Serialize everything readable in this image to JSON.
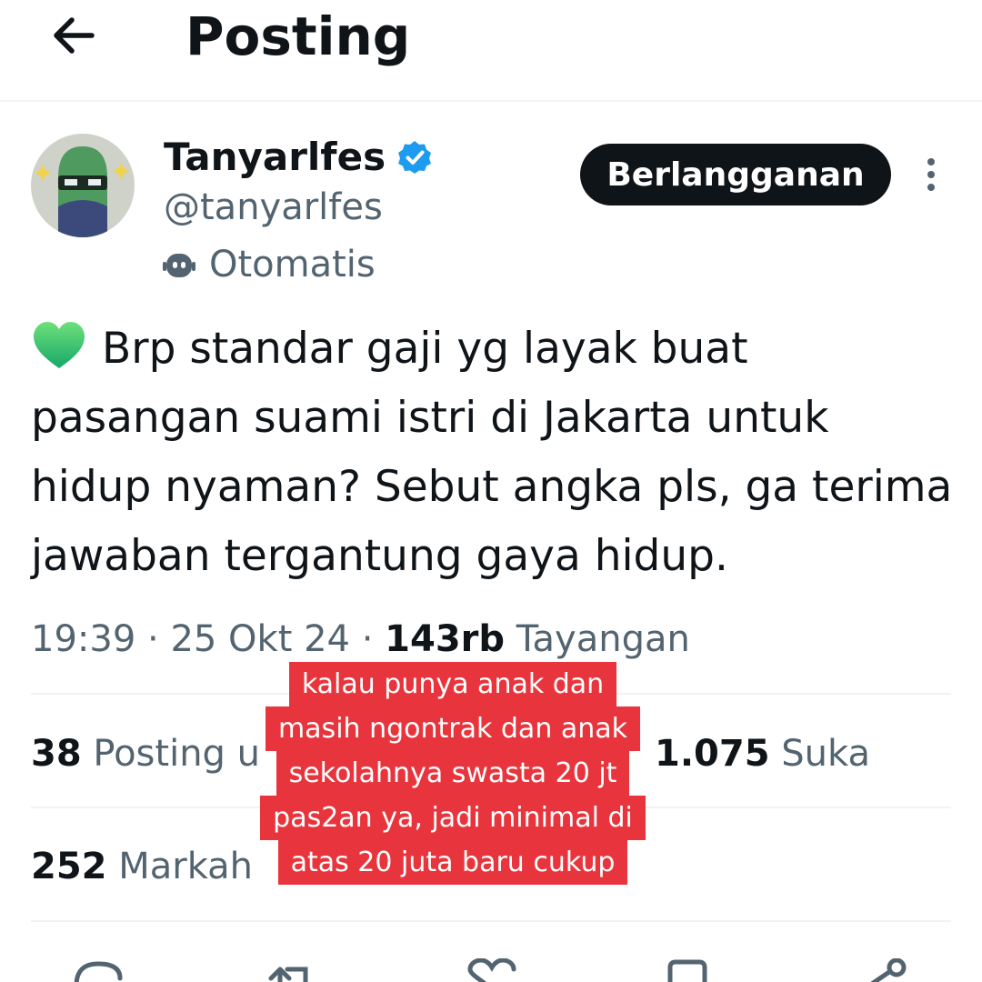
{
  "header": {
    "title": "Posting",
    "back_icon": "arrow-left-icon"
  },
  "author": {
    "name": "Tanyarlfes",
    "handle": "@tanyarlfes",
    "verified_icon": "verified-badge-icon",
    "automated_label": "Otomatis",
    "automated_icon": "robot-icon",
    "subscribe_label": "Berlangganan",
    "more_icon": "more-vertical-icon"
  },
  "tweet": {
    "emoji": "green-heart-emoji",
    "text": "Brp standar gaji yg layak buat pasangan suami istri di Jakarta untuk hidup nyaman? Sebut angka pls, ga terima jawaban tergantung gaya hidup."
  },
  "meta": {
    "time": "19:39",
    "sep1": " · ",
    "date": "25 Okt 24",
    "sep2": " · ",
    "views_count": "143rb",
    "views_label": "Tayangan"
  },
  "stats": {
    "reposts_count": "38",
    "reposts_label": "Posting u",
    "likes_count": "1.075",
    "likes_label": "Suka",
    "bookmarks_count": "252",
    "bookmarks_label": "Markah"
  },
  "overlay_caption": [
    "kalau punya anak dan",
    "masih ngontrak dan anak",
    "sekolahnya swasta 20 jt",
    "pas2an ya, jadi minimal di",
    "atas 20 juta baru cukup"
  ],
  "actions": [
    "reply-icon",
    "repost-icon",
    "like-icon",
    "bookmark-icon",
    "share-icon"
  ],
  "colors": {
    "text_primary": "#0f1419",
    "text_secondary": "#536471",
    "verified_blue": "#1d9bf0",
    "caption_red": "#e8353d"
  }
}
